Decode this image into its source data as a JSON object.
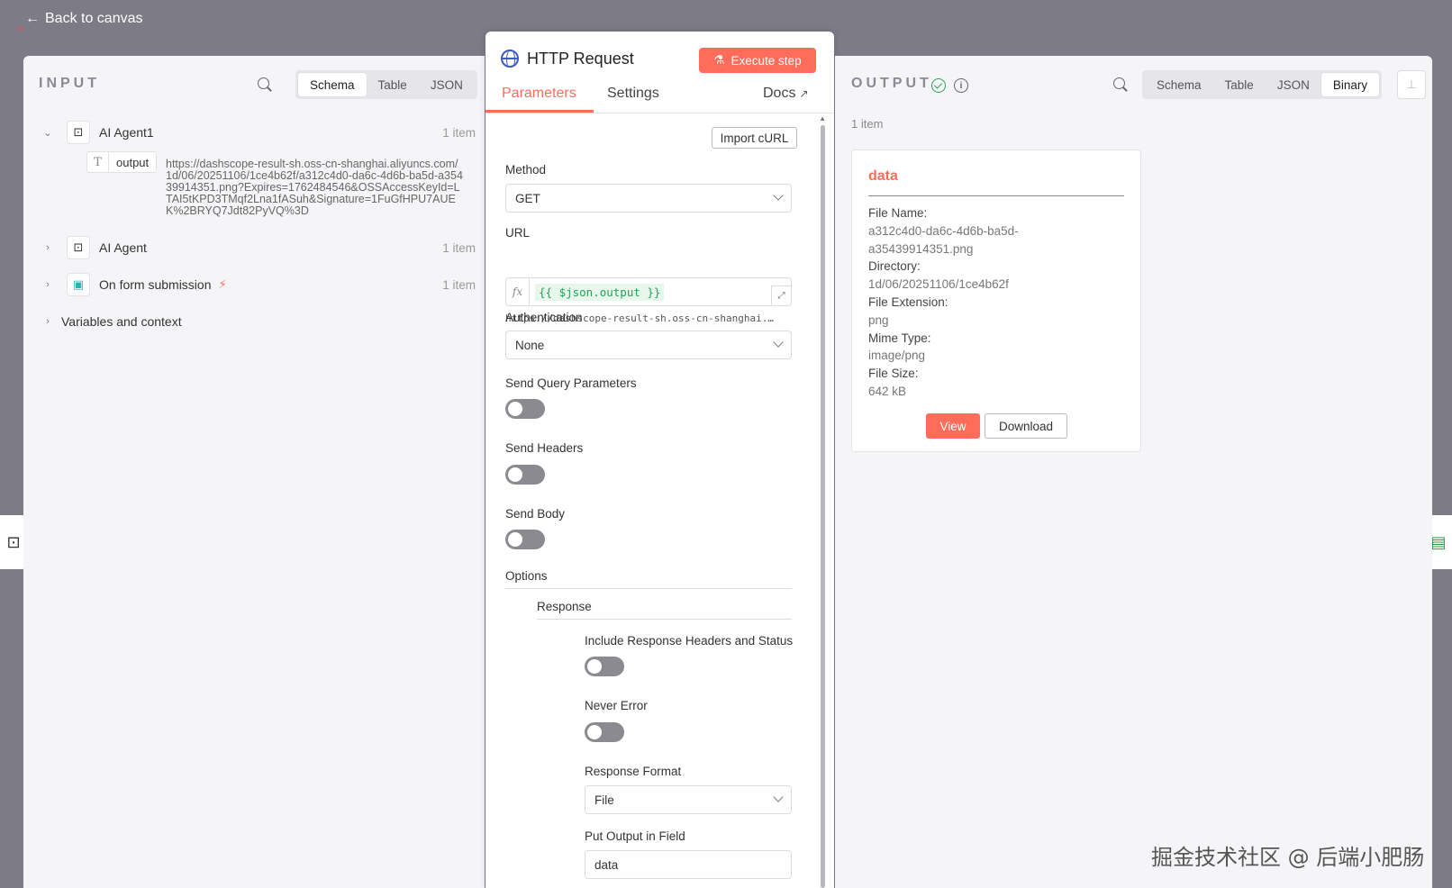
{
  "topbar": {
    "back_label": "Back to canvas"
  },
  "input": {
    "title": "INPUT",
    "views": [
      "Schema",
      "Table",
      "JSON"
    ],
    "active_view": "Schema",
    "nodes": [
      {
        "name": "AI Agent1",
        "count": "1 item",
        "expanded": true
      },
      {
        "name": "AI Agent",
        "count": "1 item",
        "expanded": false
      },
      {
        "name": "On form submission",
        "count": "1 item",
        "expanded": false
      }
    ],
    "field": {
      "key": "output",
      "value": "https://dashscope-result-sh.oss-cn-shanghai.aliyuncs.com/1d/06/20251106/1ce4b62f/a312c4d0-da6c-4d6b-ba5d-a35439914351.png?Expires=1762484546&OSSAccessKeyId=LTAI5tKPD3TMqf2Lna1fASuh&Signature=1FuGfHPU7AUEK%2BRYQ7Jdt82PyVQ%3D"
    },
    "variables_label": "Variables and context"
  },
  "node": {
    "title": "HTTP Request",
    "execute_label": "Execute step",
    "tabs": {
      "parameters": "Parameters",
      "settings": "Settings",
      "docs": "Docs"
    },
    "import_curl": "Import cURL",
    "method": {
      "label": "Method",
      "value": "GET"
    },
    "url": {
      "label": "URL",
      "expression": "{{ $json.output }}",
      "preview": "https://dashscope-result-sh.oss-cn-shanghai.…"
    },
    "authentication": {
      "label": "Authentication",
      "value": "None"
    },
    "send_query": {
      "label": "Send Query Parameters",
      "on": false
    },
    "send_headers": {
      "label": "Send Headers",
      "on": false
    },
    "send_body": {
      "label": "Send Body",
      "on": false
    },
    "options_label": "Options",
    "response_label": "Response",
    "include_headers": {
      "label": "Include Response Headers and Status",
      "on": false
    },
    "never_error": {
      "label": "Never Error",
      "on": false
    },
    "response_format": {
      "label": "Response Format",
      "value": "File"
    },
    "output_field": {
      "label": "Put Output in Field",
      "value": "data"
    }
  },
  "output": {
    "title": "OUTPUT",
    "views": [
      "Schema",
      "Table",
      "JSON",
      "Binary"
    ],
    "active_view": "Binary",
    "item_count": "1 item",
    "card": {
      "title": "data",
      "file_name_label": "File Name:",
      "file_name_line1": "a312c4d0-da6c-4d6b-ba5d-",
      "file_name_line2": "a35439914351.png",
      "directory_label": "Directory:",
      "directory": "1d/06/20251106/1ce4b62f",
      "extension_label": "File Extension:",
      "extension": "png",
      "mime_label": "Mime Type:",
      "mime": "image/png",
      "size_label": "File Size:",
      "size": "642 kB",
      "view_label": "View",
      "download_label": "Download"
    }
  },
  "watermark": "掘金技术社区 @ 后端小肥肠",
  "colors": {
    "accent": "#ff6d5a",
    "success": "#2ea35a",
    "expression": "#22a35a",
    "link_icon": "#3b5cc4"
  }
}
